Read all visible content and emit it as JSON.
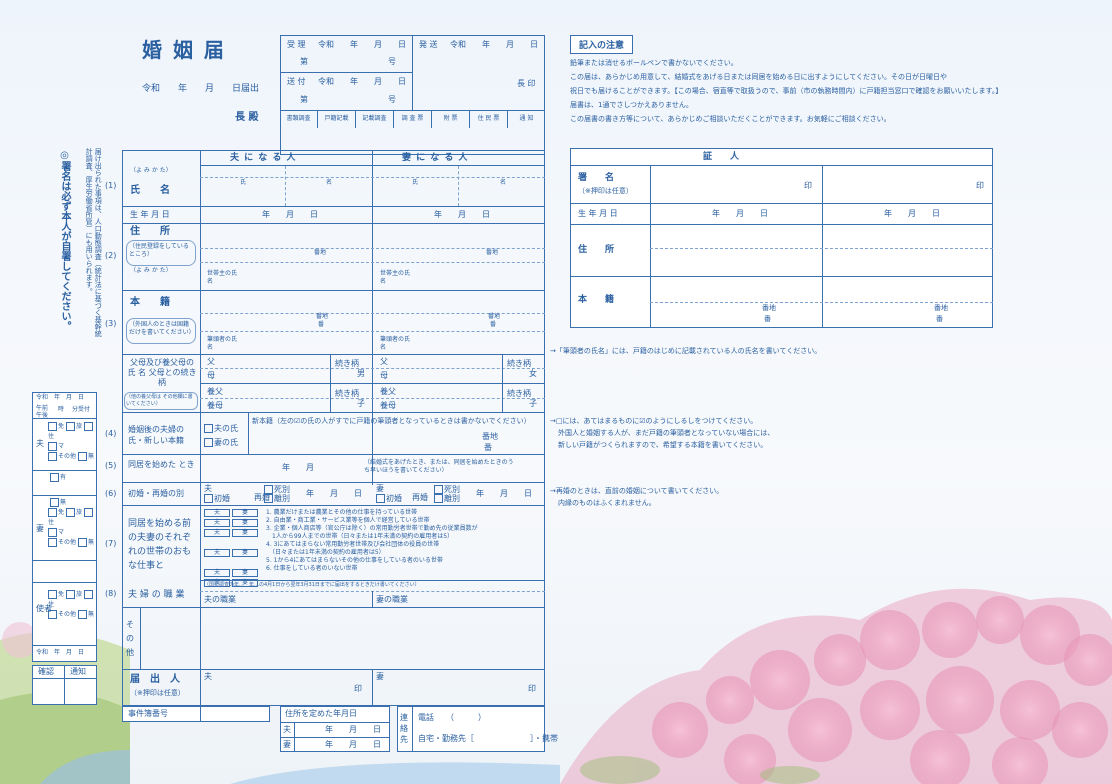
{
  "form": {
    "title": "婚 姻 届",
    "date_line": "令和　　年　　月　　日届出",
    "chou_dono": "長 殿",
    "juri": "受 理",
    "reiwa_ymd": "令和　　年　　月　　日",
    "dai": "第",
    "gou": "号",
    "soufu": "送 付",
    "souhatsu": "発 送",
    "chou_in": "長 印",
    "review_cols": [
      "書類調査",
      "戸籍記載",
      "記載調査",
      "調 査 票",
      "附 票",
      "住 民 票",
      "通 知"
    ],
    "fill_reminder": "◎署名は必ず本人が自署してください。",
    "statistics_note": "届け出られた事項は、人口動態調査（統計法に基づく基幹統計調査、厚生労働省所管）にも用いられます。"
  },
  "rows": {
    "husband_header": "夫 に な る 人",
    "wife_header": "妻 に な る 人",
    "yomikata": "（よ み か た）",
    "name": "氏　　名",
    "family_name": "氏",
    "given_name": "名",
    "birthdate": "生 年 月 日",
    "ymd": "年　　月　　日",
    "address": "住　　所",
    "address_note": "（住民登録をしているところ）",
    "address_yomikata": "（よ み か た）",
    "household_head": "世帯主の氏名",
    "banchi": "番地",
    "ban": "番",
    "honseki": "本　　籍",
    "honseki_note": "（外国人のときは国籍だけを書いてください）",
    "hittousha": "筆頭者の氏名",
    "parents_label": "父母及び養父母の 氏 名 父母との続き柄",
    "parents_note": "（他の養父母は その他欄に書いてください）",
    "father": "父",
    "mother": "母",
    "adopt_father": "養父",
    "adopt_mother": "養母",
    "relation": "続き柄",
    "male": "男",
    "female": "女",
    "child": "子",
    "new_surname_label": "婚姻後の夫婦の 氏・新しい本籍",
    "husband_surname": "夫の氏",
    "wife_surname": "妻の氏",
    "new_honseki": "新本籍（左の☑の氏の人がすでに戸籍の筆頭者となっているときは書かないでください）",
    "cohab_label": "同居を始めた とき",
    "cohab_value": "年　　月",
    "cohab_note": "（結婚式をあげたとき、または、同居を始めたときのうち早いほうを書いてください）",
    "first_remarriage": "初婚・再婚の別",
    "first": "初婚",
    "remarriage": "再婚",
    "death": "死別",
    "divorce": "離別",
    "husband_short": "夫",
    "wife_short": "妻",
    "work_label": "同居を始める前の夫妻のそれぞれの世帯のおもな仕事と",
    "work_items": [
      "1. 農業だけまたは農業とその他の仕事を持っている世帯",
      "2. 自由業・商工業・サービス業等を個人で経営している世帯",
      "3. 企業・個人商店等（官公庁は除く）の常用勤労者世帯で勤め先の従業員数が",
      "　1人から99人までの世帯（日々または1年未満の契約の雇用者は5）",
      "4. 3にあてはまらない常用勤労者世帯及び会社団体の役員の世帯",
      "　（日々または1年未満の契約の雇用者は5）",
      "5. 1から4にあてはまらないその他の仕事をしている者のいる世帯",
      "6. 仕事をしている者のいない世帯"
    ],
    "census_note": "（国勢調査の年…　年…の4月1日から翌年3月31日までに届出をするときだけ書いてください）",
    "occupation_label": "夫 婦 の 職 業",
    "husband_job": "夫の職業",
    "wife_job": "妻の職業",
    "other": "そ の 他",
    "applicant": "届　出　人",
    "applicant_note": "（※押印は任意）",
    "seal": "印",
    "case_number": "事件簿番号",
    "residence_date": "住所を定めた年月日",
    "contact": "連絡先",
    "phone": "電話　　（　　　）",
    "work_phone": "自宅・勤務先［　　　　　　　］・携帯",
    "row_numbers": [
      "(1)",
      "(2)",
      "(3)",
      "(4)",
      "(5)",
      "(6)",
      "(7)",
      "(8)"
    ]
  },
  "side": {
    "reiwa_ymd": "令和　年　月　日",
    "am_pm": "午前 午後",
    "hour": "時",
    "minute": "分受付",
    "husband": "夫",
    "wife": "妻",
    "witness": "使者",
    "options": [
      "免",
      "旅",
      "住",
      "マ",
      "その他",
      "無"
    ],
    "yes": "有",
    "no": "無",
    "inquiry": "確認",
    "notice": "通知"
  },
  "notes": {
    "heading": "記入の注意",
    "lines": [
      "鉛筆または消せるボールペンで書かないでください。",
      "この届は、あらかじめ用意して、結婚式をあげる日または同居を始める日に出すようにしてください。その日が日曜日や",
      "祝日でも届けることができます。【この場合、宿直等で取扱うので、事前（市の執務時間内）に戸籍担当窓口で確認をお願いいたします。】",
      "届書は、1通でさしつかえありません。",
      "この届書の書き方等について、あらかじめご相談いただくことができます。お気軽にご相談ください。"
    ],
    "hittousha_note": "→「筆頭者の氏名」には、戸籍のはじめに記載されている人の氏名を書いてください。",
    "check_note_1": "→□には、あてはまるものに☑のようにしるしをつけてください。",
    "check_note_2": "外国人と婚姻する人が、まだ戸籍の筆頭者となっていない場合には、",
    "check_note_3": "新しい戸籍がつくられますので、希望する本籍を書いてください。",
    "remarriage_note_1": "→再婚のときは、直前の婚姻について書いてください。",
    "remarriage_note_2": "内縁のものはふくまれません。"
  },
  "witness": {
    "title": "証　　人",
    "signature": "署　　名",
    "signature_note": "（※押印は任意）",
    "seal": "印",
    "birthdate": "生 年 月 日",
    "ymd": "年　　月　　日",
    "address": "住　　所",
    "honseki": "本　　籍",
    "banchi": "番地",
    "ban": "番"
  }
}
